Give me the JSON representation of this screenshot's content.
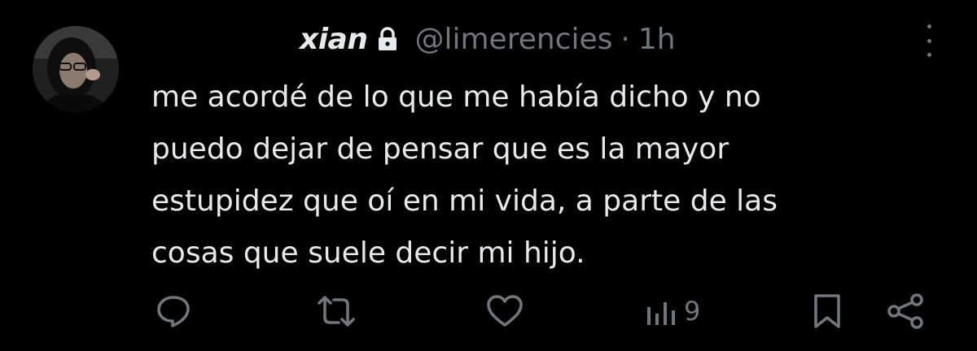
{
  "tweet": {
    "author": {
      "display_name": "xian",
      "handle": "@limerencies",
      "protected_icon": "lock-icon",
      "avatar_icon": "profile-photo"
    },
    "separator": "·",
    "time": "1h",
    "text_lines": [
      "me acordé de lo que me había dicho y no",
      "puedo dejar de pensar que es la mayor",
      "estupidez que oí en mi vida, a parte de las",
      "cosas que suele decir mi hijo."
    ],
    "actions": {
      "reply_icon": "reply-icon",
      "retweet_icon": "retweet-icon",
      "like_icon": "heart-icon",
      "views_icon": "views-icon",
      "views_count": "9",
      "bookmark_icon": "bookmark-icon",
      "share_icon": "share-icon"
    }
  },
  "colors": {
    "background": "#000000",
    "primary_text": "#e7e9ea",
    "secondary_text": "#71767b"
  }
}
